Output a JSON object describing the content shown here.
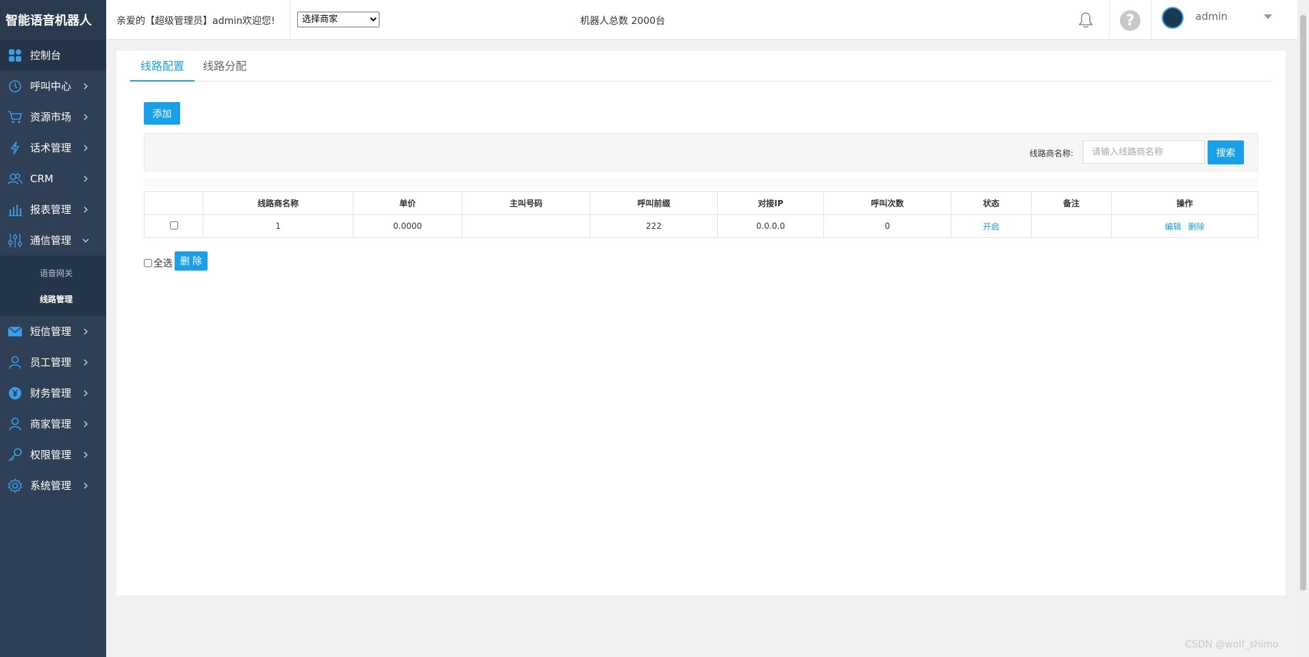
{
  "app": {
    "title": "智能语音机器人"
  },
  "sidebar": {
    "items": [
      {
        "label": "控制台",
        "icon": "dashboard-icon"
      },
      {
        "label": "呼叫中心",
        "icon": "clock-icon"
      },
      {
        "label": "资源市场",
        "icon": "cart-icon"
      },
      {
        "label": "话术管理",
        "icon": "lightning-icon"
      },
      {
        "label": "CRM",
        "icon": "users-icon"
      },
      {
        "label": "报表管理",
        "icon": "bar-chart-icon"
      },
      {
        "label": "通信管理",
        "icon": "sliders-icon"
      },
      {
        "label": "短信管理",
        "icon": "mail-icon"
      },
      {
        "label": "员工管理",
        "icon": "user-icon"
      },
      {
        "label": "财务管理",
        "icon": "yen-icon"
      },
      {
        "label": "商家管理",
        "icon": "user-icon"
      },
      {
        "label": "权限管理",
        "icon": "key-icon"
      },
      {
        "label": "系统管理",
        "icon": "gear-icon"
      }
    ],
    "sub_items": [
      {
        "label": "语音网关"
      },
      {
        "label": "线路管理"
      }
    ]
  },
  "header": {
    "welcome": "亲爱的【超级管理员】admin欢迎您!",
    "merchant_select": {
      "selected": "选择商家"
    },
    "robot_total": "机器人总数 2000台",
    "username": "admin"
  },
  "tabs": [
    {
      "label": "线路配置",
      "active": true
    },
    {
      "label": "线路分配",
      "active": false
    }
  ],
  "toolbar": {
    "add_label": "添加"
  },
  "search": {
    "label": "线路商名称:",
    "placeholder": "请输入线路商名称",
    "button_label": "搜索"
  },
  "table": {
    "columns": [
      "",
      "线路商名称",
      "单价",
      "主叫号码",
      "呼叫前缀",
      "对接IP",
      "呼叫次数",
      "状态",
      "备注",
      "操作"
    ],
    "rows": [
      {
        "name": "1",
        "price": "0.0000",
        "caller_number": "",
        "prefix": "222",
        "ip": "0.0.0.0",
        "call_count": "0",
        "status": "开启",
        "remark": "",
        "edit_label": "编辑",
        "delete_label": "删除"
      }
    ]
  },
  "footer_actions": {
    "select_all_label": "全选",
    "delete_label": "删 除"
  },
  "watermark": "CSDN @wolf_shimo",
  "colors": {
    "sidebar_bg": "#2f4056",
    "accent": "#1aa0e8",
    "link": "#1aa0dc"
  }
}
